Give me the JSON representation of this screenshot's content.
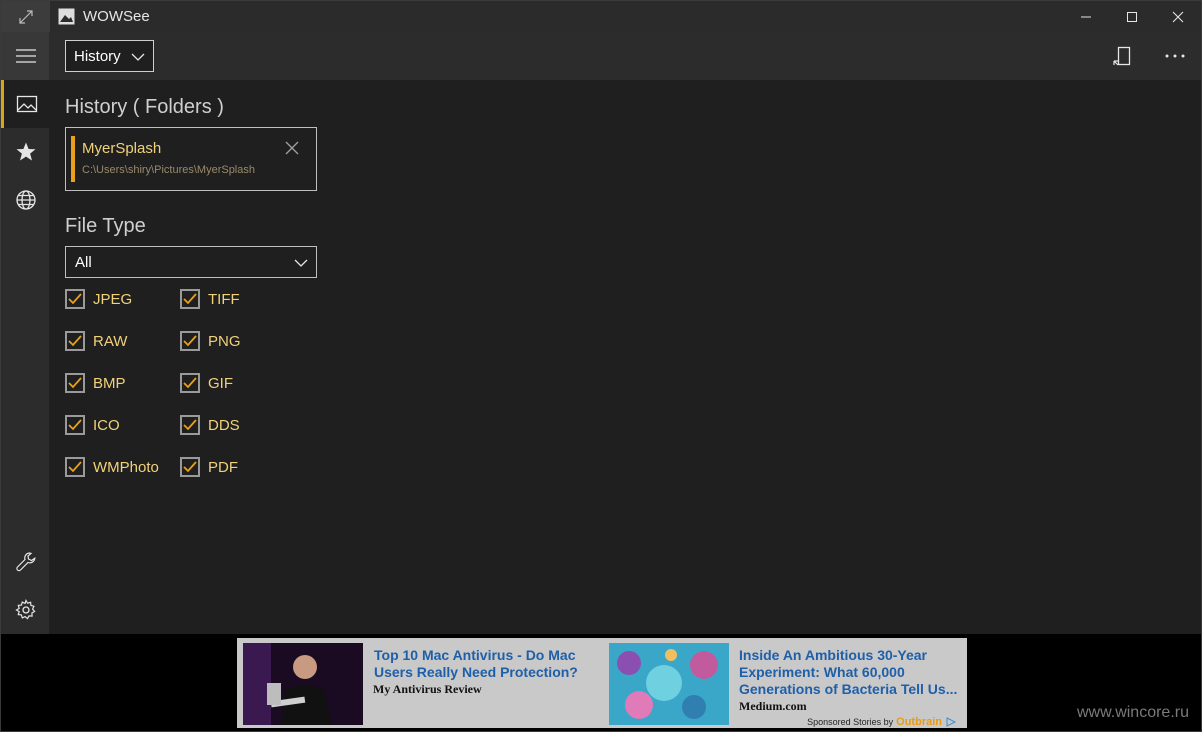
{
  "app": {
    "title": "WOWSee"
  },
  "window_controls": {
    "expand": "expand-icon",
    "minimize": "minimize-icon",
    "maximize": "maximize-icon",
    "close": "close-icon"
  },
  "command_bar": {
    "view_select": "History"
  },
  "nav": {
    "items": [
      "hamburger-icon",
      "image-icon",
      "star-icon",
      "globe-icon",
      "wrench-icon",
      "gear-icon"
    ],
    "active": "image-icon",
    "accent": "#d9a418"
  },
  "main": {
    "history_title": "History ( Folders )",
    "folder": {
      "name": "MyerSplash",
      "path": "C:\\Users\\shiry\\Pictures\\MyerSplash"
    },
    "file_type_title": "File Type",
    "file_type_select": "All",
    "checkboxes": [
      "JPEG",
      "TIFF",
      "RAW",
      "PNG",
      "BMP",
      "GIF",
      "ICO",
      "DDS",
      "WMPhoto",
      "PDF"
    ]
  },
  "ad": {
    "left": {
      "headline": "Top 10 Mac Antivirus - Do Mac Users Really Need Protection?",
      "source": "My Antivirus Review"
    },
    "right": {
      "headline": "Inside An Ambitious 30-Year Experiment: What 60,000 Generations of Bacteria Tell Us...",
      "source": "Medium.com"
    },
    "sponsor_label": "Sponsored Stories by",
    "sponsor_brand": "Outbrain"
  },
  "watermark": "www.wincore.ru",
  "colors": {
    "accent": "#e9a11a",
    "label": "#f1d27a",
    "link": "#1f5fa8"
  }
}
